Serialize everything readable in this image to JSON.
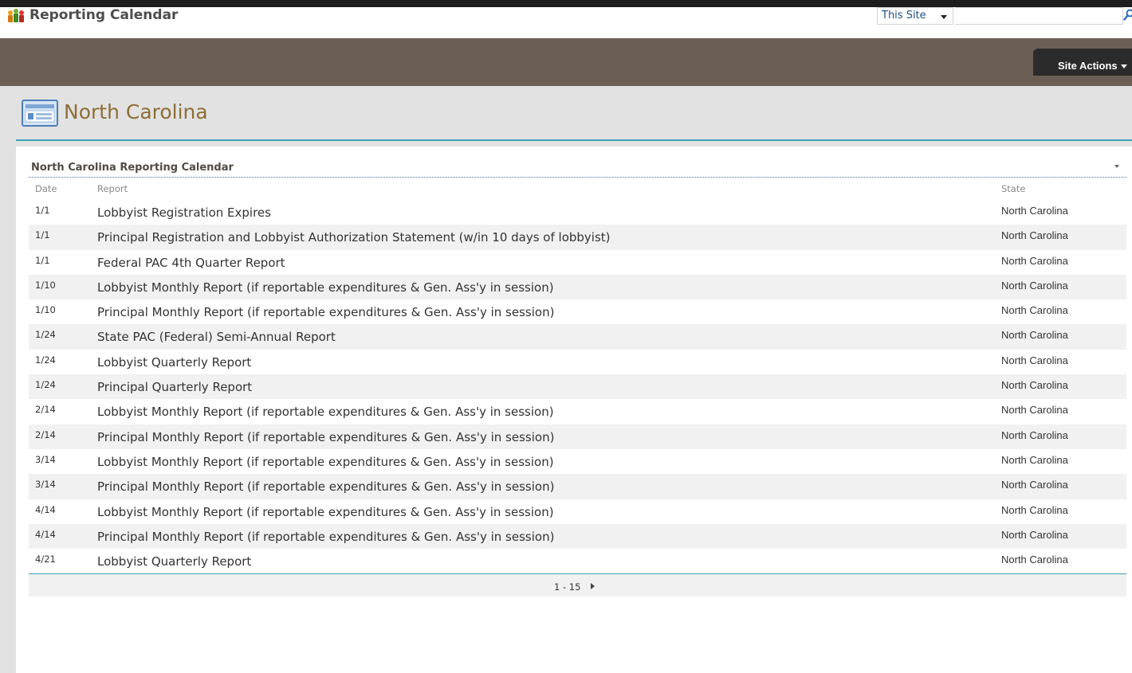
{
  "site": {
    "title": "Reporting Calendar"
  },
  "search": {
    "scope": "This Site",
    "value": ""
  },
  "ribbon": {
    "site_actions": "Site Actions"
  },
  "page": {
    "title": "North Carolina"
  },
  "webpart": {
    "title": "North Carolina Reporting Calendar"
  },
  "list": {
    "columns": {
      "date": "Date",
      "report": "Report",
      "state": "State"
    },
    "rows": [
      {
        "date": "1/1",
        "report": "Lobbyist Registration Expires",
        "state": "North Carolina"
      },
      {
        "date": "1/1",
        "report": "Principal Registration and Lobbyist Authorization Statement  (w/in 10 days of lobbyist)",
        "state": "North Carolina"
      },
      {
        "date": "1/1",
        "report": "Federal PAC 4th Quarter Report",
        "state": "North Carolina"
      },
      {
        "date": "1/10",
        "report": "Lobbyist Monthly Report (if reportable expenditures & Gen. Ass'y in session)",
        "state": "North Carolina"
      },
      {
        "date": "1/10",
        "report": "Principal Monthly Report (if reportable expenditures & Gen. Ass'y in session)",
        "state": "North Carolina"
      },
      {
        "date": "1/24",
        "report": "State PAC (Federal) Semi-Annual Report",
        "state": "North Carolina"
      },
      {
        "date": "1/24",
        "report": "Lobbyist Quarterly Report",
        "state": "North Carolina"
      },
      {
        "date": "1/24",
        "report": "Principal Quarterly Report",
        "state": "North Carolina"
      },
      {
        "date": "2/14",
        "report": "Lobbyist Monthly Report (if reportable expenditures & Gen. Ass'y in session)",
        "state": "North Carolina"
      },
      {
        "date": "2/14",
        "report": "Principal Monthly Report (if reportable expenditures & Gen. Ass'y in session)",
        "state": "North Carolina"
      },
      {
        "date": "3/14",
        "report": "Lobbyist Monthly Report (if reportable expenditures & Gen. Ass'y in session)",
        "state": "North Carolina"
      },
      {
        "date": "3/14",
        "report": "Principal Monthly Report (if reportable expenditures & Gen. Ass'y in session)",
        "state": "North Carolina"
      },
      {
        "date": "4/14",
        "report": "Lobbyist Monthly Report (if reportable expenditures & Gen. Ass'y in session)",
        "state": "North Carolina"
      },
      {
        "date": "4/14",
        "report": "Principal Monthly Report (if reportable expenditures & Gen. Ass'y in session)",
        "state": "North Carolina"
      },
      {
        "date": "4/21",
        "report": "Lobbyist Quarterly Report",
        "state": "North Carolina"
      }
    ],
    "pager": "1 - 15"
  },
  "icons": {
    "logo": "site-logo-icon",
    "search": "search-icon",
    "page": "page-icon",
    "next": "next-page-icon"
  },
  "colors": {
    "brown_bar": "#6b5f55",
    "accent_line": "#3ea2b4",
    "page_title": "#8d6d37",
    "scope_text": "#1f4f8a"
  }
}
